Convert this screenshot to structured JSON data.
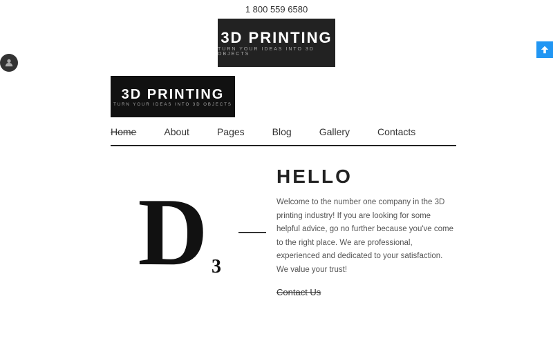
{
  "topBar": {
    "phone": "1 800 559 6580"
  },
  "heroBanner": {
    "mainTitle": "3D PRINTING",
    "subTitle": "TURN YOUR IDEAS INTO 3D OBJECTS"
  },
  "logo": {
    "mainTitle": "3D PRINTING",
    "subTitle": "TURN YOUR IDEAS INTO 3D OBJECTS"
  },
  "nav": {
    "items": [
      {
        "label": "Home",
        "active": true
      },
      {
        "label": "About",
        "active": false
      },
      {
        "label": "Pages",
        "active": false
      },
      {
        "label": "Blog",
        "active": false
      },
      {
        "label": "Gallery",
        "active": false
      },
      {
        "label": "Contacts",
        "active": false
      }
    ]
  },
  "hero": {
    "bigLetter": "D",
    "smallNumber": "3",
    "title": "HELLO",
    "description": "Welcome to the number one company in the 3D printing industry! If you are looking for some helpful advice, go no further because you've come to the right place. We are professional, experienced and dedicated to your satisfaction. We value your trust!",
    "contactLabel": "Contact Us"
  }
}
